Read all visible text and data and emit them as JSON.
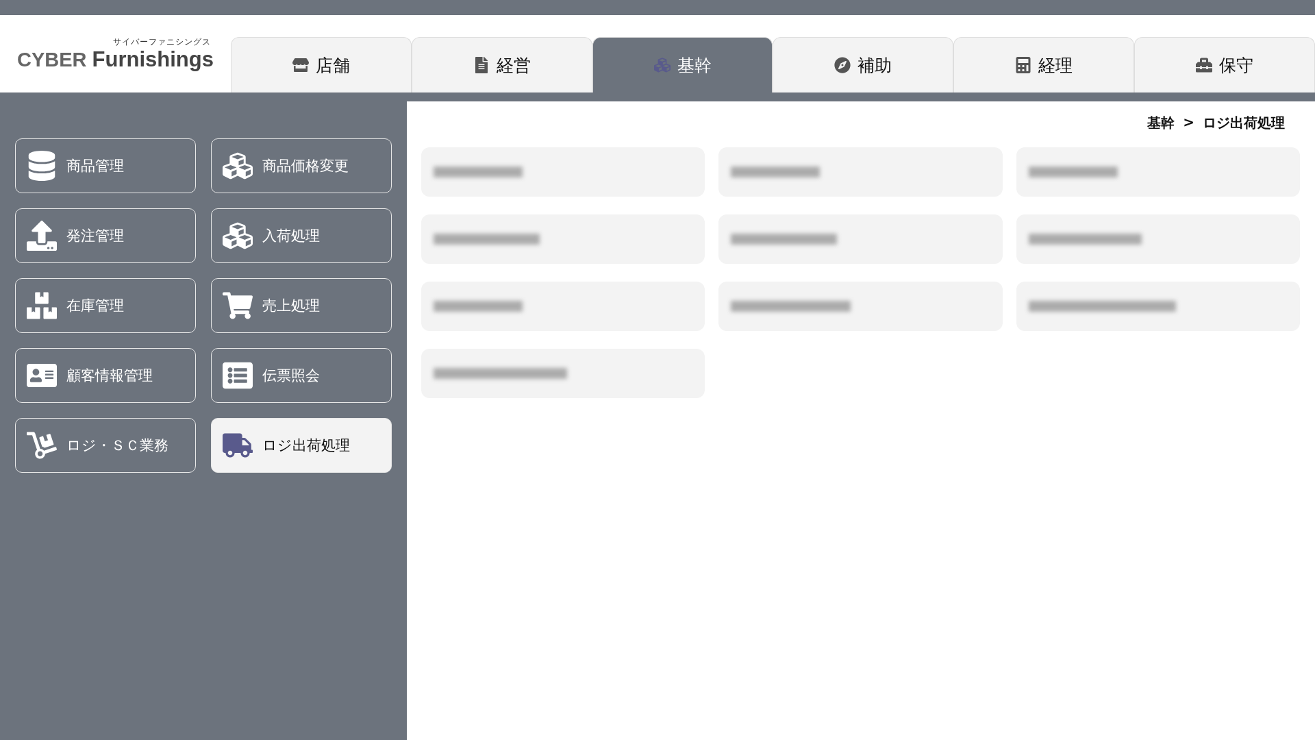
{
  "logo": {
    "name_1": "CYBER",
    "name_2": "Furnishings",
    "kana": "サイバーファニシングス"
  },
  "tabs": [
    {
      "label": "店舗",
      "selected": false
    },
    {
      "label": "経営",
      "selected": false
    },
    {
      "label": "基幹",
      "selected": true
    },
    {
      "label": "補助",
      "selected": false
    },
    {
      "label": "経理",
      "selected": false
    },
    {
      "label": "保守",
      "selected": false
    }
  ],
  "sidebar": {
    "items": [
      {
        "label": "商品管理",
        "selected": false
      },
      {
        "label": "商品価格変更",
        "selected": false
      },
      {
        "label": "発注管理",
        "selected": false
      },
      {
        "label": "入荷処理",
        "selected": false
      },
      {
        "label": "在庫管理",
        "selected": false
      },
      {
        "label": "売上処理",
        "selected": false
      },
      {
        "label": "顧客情報管理",
        "selected": false
      },
      {
        "label": "伝票照会",
        "selected": false
      },
      {
        "label": "ロジ・ＳＣ業務",
        "selected": false
      },
      {
        "label": "ロジ出荷処理",
        "selected": true
      }
    ]
  },
  "breadcrumb": {
    "parent": "基幹",
    "separator": ">",
    "current": "ロジ出荷処理"
  },
  "menu_items": [
    {
      "kind": "blurred"
    },
    {
      "kind": "blurred"
    },
    {
      "kind": "blurred"
    },
    {
      "kind": "blurred"
    },
    {
      "kind": "blurred"
    },
    {
      "kind": "blurred"
    },
    {
      "kind": "blurred"
    },
    {
      "kind": "blurred"
    },
    {
      "kind": "blurred"
    },
    {
      "kind": "blurred"
    }
  ]
}
